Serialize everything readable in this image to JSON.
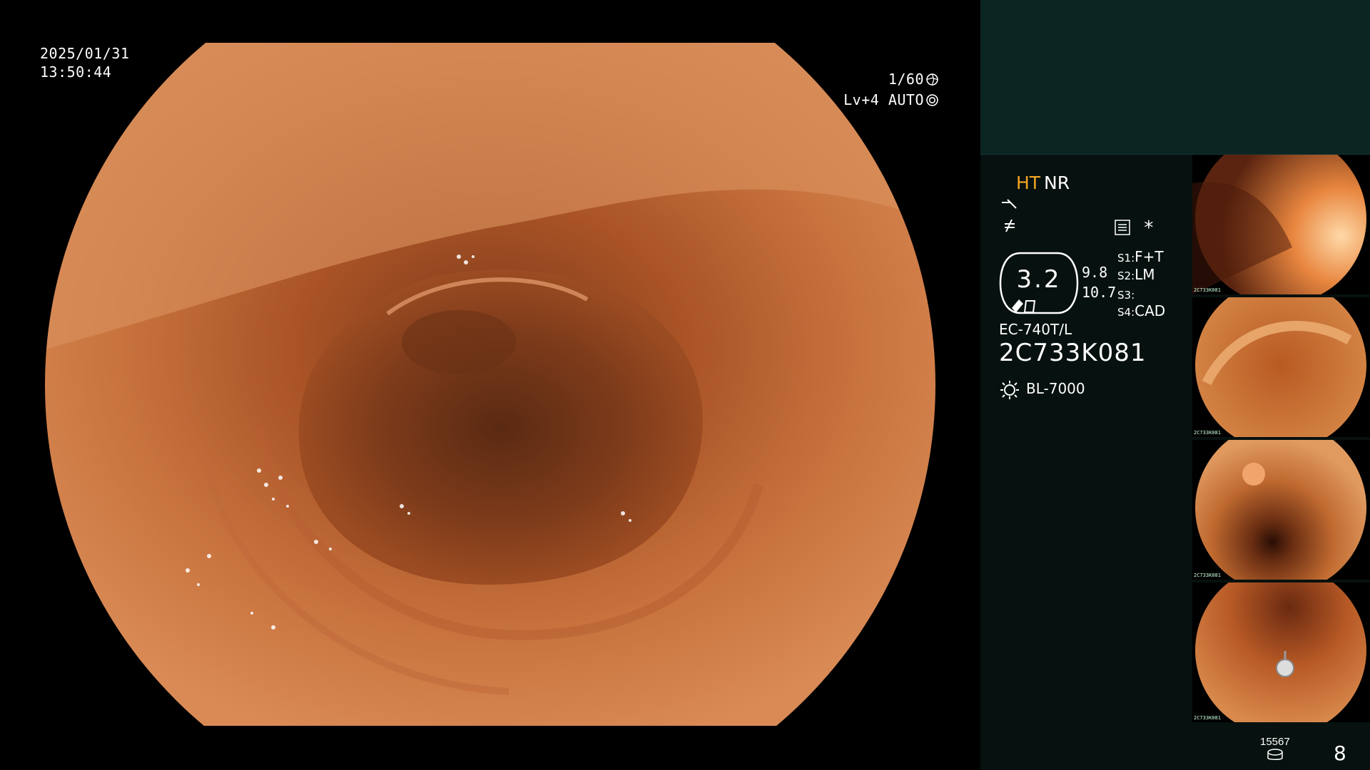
{
  "overlay": {
    "date": "2025/01/31",
    "time": "13:50:44",
    "shutter": "1/60",
    "iris": "Lv+4 AUTO"
  },
  "panel": {
    "mode_ht": "HT",
    "mode_nr": "NR",
    "zoom": "3.2",
    "value_a": "9.8",
    "value_b": "10.7",
    "switches": [
      {
        "key": "S1:",
        "value": "F+T"
      },
      {
        "key": "S2:",
        "value": "LM"
      },
      {
        "key": "S3:",
        "value": ""
      },
      {
        "key": "S4:",
        "value": "CAD"
      }
    ],
    "scope_model": "EC-740T/L",
    "scope_serial": "2C733K081",
    "light_source": "BL-7000",
    "storage_count": "15567",
    "page_number": "8",
    "asterisk": "*"
  },
  "thumbnails": [
    {
      "caption": "2C733K081"
    },
    {
      "caption": "2C733K081"
    },
    {
      "caption": "2C733K081"
    },
    {
      "caption": "2C733K081"
    }
  ],
  "icons": {
    "shutter": "shutter-icon",
    "iris": "iris-icon",
    "enhancement": "structure-enhancement-icon",
    "color": "color-enhancement-icon",
    "menu": "menu-icon",
    "light": "light-source-icon",
    "storage": "storage-icon"
  },
  "colors": {
    "accent_ht": "#f5a623",
    "panel_bg": "#07110f",
    "panel_top": "#0b2523"
  }
}
